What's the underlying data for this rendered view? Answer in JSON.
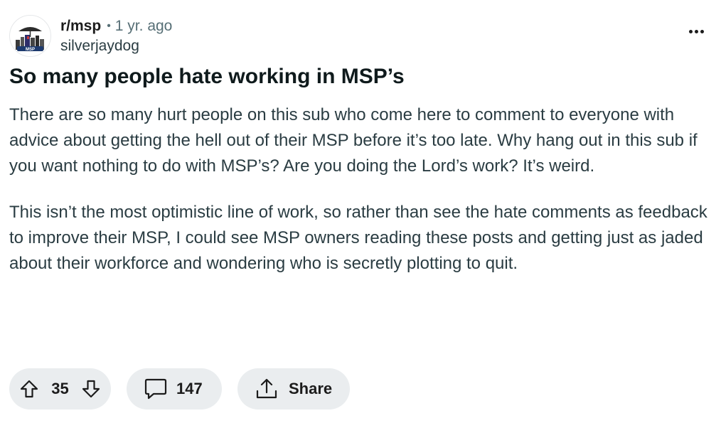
{
  "post": {
    "subreddit": "r/msp",
    "separator": "•",
    "time_ago": "1 yr. ago",
    "author": "silverjaydog",
    "title": "So many people hate working in MSP’s",
    "paragraphs": [
      "There are so many hurt people on this sub who come here to comment to everyone with advice about getting the hell out of their MSP before it’s too late. Why hang out in this sub if you want nothing to do with MSP’s? Are you doing the Lord’s work? It’s weird.",
      "This isn’t the most optimistic line of work, so rather than see the hate comments as feedback to improve their MSP, I could see MSP owners reading these posts and getting just as jaded about their workforce and wondering who is secretly plotting to quit."
    ]
  },
  "actions": {
    "vote_count": "35",
    "comment_count": "147",
    "share_label": "Share"
  },
  "icons": {
    "avatar": "subreddit-avatar",
    "overflow": "more-options-icon",
    "upvote": "upvote-arrow-icon",
    "downvote": "downvote-arrow-icon",
    "comment": "comment-bubble-icon",
    "share": "share-icon"
  },
  "colors": {
    "text_primary": "#0f1a1c",
    "text_secondary": "#576f76",
    "body_text": "#2a3c42",
    "pill_bg": "#eaedef"
  }
}
